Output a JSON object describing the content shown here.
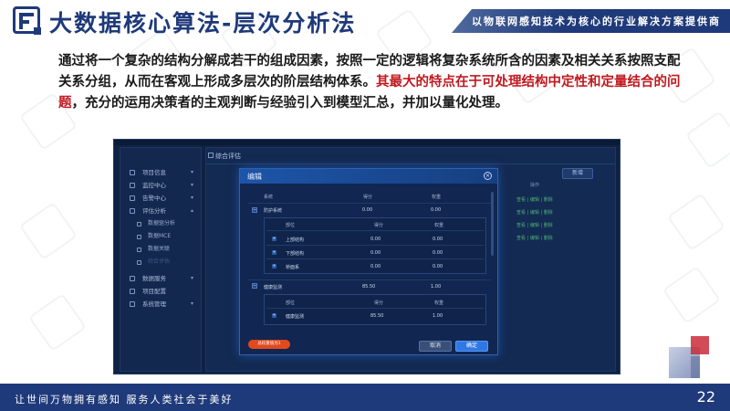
{
  "header": {
    "title": "大数据核心算法-层次分析法",
    "tagline": "以物联网感知技术为核心的行业解决方案提供商"
  },
  "intro": {
    "text_before": "通过将一个复杂的结构分解成若干的组成因素，按照一定的逻辑将复杂系统所含的因素及相关关系按照支配关系分组，从而在客观上形成多层次的阶层结构体系。",
    "text_highlight": "其最大的特点在于可处理结构中定性和定量结合的问题",
    "text_after": "，充分的运用决策者的主观判断与经验引入到模型汇总，并加以量化处理。"
  },
  "app": {
    "page_title": "综合评估",
    "new_button": "新增",
    "ops_header": "操作",
    "op_link_text": "查看 | 编辑 | 删除",
    "sidebar": {
      "items": [
        {
          "label": "项目信息",
          "chevron": "▾"
        },
        {
          "label": "监控中心",
          "chevron": "▾"
        },
        {
          "label": "告警中心",
          "chevron": "▾"
        },
        {
          "label": "评估分析",
          "chevron": "▴"
        },
        {
          "label": "数据服务",
          "chevron": "▾"
        },
        {
          "label": "项目配置",
          "chevron": ""
        },
        {
          "label": "系统管理",
          "chevron": "▾"
        }
      ],
      "subitems": [
        {
          "label": "数据驱分析"
        },
        {
          "label": "数据MCE"
        },
        {
          "label": "数据关联"
        },
        {
          "label": "综合评估"
        }
      ]
    }
  },
  "modal": {
    "title": "编辑",
    "close": "×",
    "columns": {
      "system": "系统",
      "score": "得分",
      "weight": "权重"
    },
    "sub_columns": {
      "part": "部位",
      "score": "得分",
      "weight": "权重"
    },
    "groups": [
      {
        "sign": "−",
        "name": "防护系统",
        "score": "0.00",
        "weight": "0.00",
        "parts": [
          {
            "name": "上部结构",
            "score": "0.00",
            "weight": "0.00"
          },
          {
            "name": "下部结构",
            "score": "0.00",
            "weight": "0.00"
          },
          {
            "name": "桥面系",
            "score": "0.00",
            "weight": "0.00"
          }
        ]
      },
      {
        "sign": "−",
        "name": "健康监测",
        "score": "85.50",
        "weight": "1.00",
        "parts": [
          {
            "name": "健康监测",
            "score": "85.50",
            "weight": "1.00"
          }
        ]
      }
    ],
    "tip_button": "总权重值为1",
    "cancel_button": "取消",
    "ok_button": "确定"
  },
  "footer": {
    "slogan": "让世间万物拥有感知    服务人类社会于美好",
    "page_number": "22"
  },
  "colors": {
    "brand": "#1f3a7a",
    "highlight": "#c0191f",
    "accent_blue": "#2e78e6",
    "tip_orange": "#e14a1d"
  }
}
